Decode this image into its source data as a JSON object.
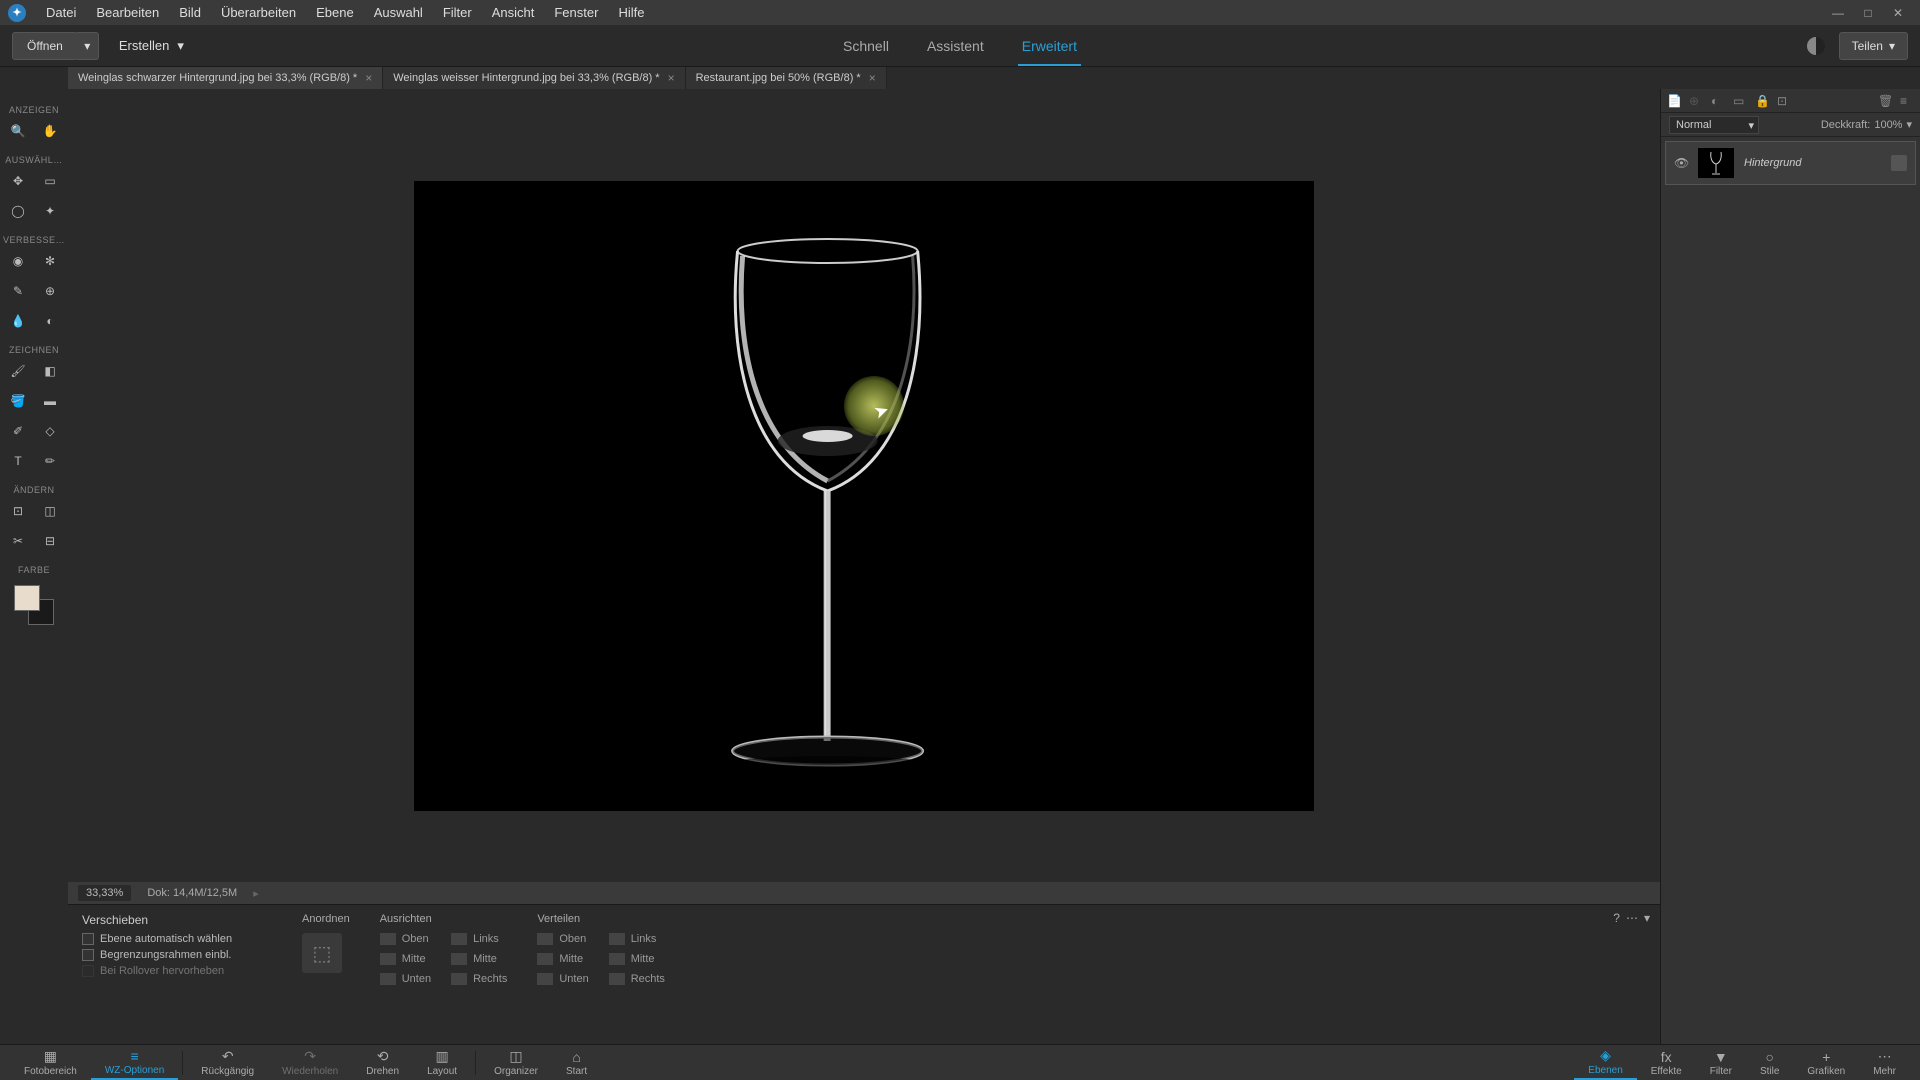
{
  "menu": {
    "items": [
      "Datei",
      "Bearbeiten",
      "Bild",
      "Überarbeiten",
      "Ebene",
      "Auswahl",
      "Filter",
      "Ansicht",
      "Fenster",
      "Hilfe"
    ]
  },
  "actionbar": {
    "open": "Öffnen",
    "create": "Erstellen",
    "share": "Teilen"
  },
  "modes": {
    "quick": "Schnell",
    "guided": "Assistent",
    "expert": "Erweitert"
  },
  "tabs": [
    {
      "label": "Weinglas schwarzer Hintergrund.jpg bei 33,3% (RGB/8) *",
      "active": true
    },
    {
      "label": "Weinglas weisser Hintergrund.jpg bei 33,3% (RGB/8) *",
      "active": false
    },
    {
      "label": "Restaurant.jpg bei 50% (RGB/8) *",
      "active": false
    }
  ],
  "toolbar": {
    "sections": {
      "view": "ANZEIGEN",
      "select": "AUSWÄHL…",
      "enhance": "VERBESSE…",
      "draw": "ZEICHNEN",
      "modify": "ÄNDERN",
      "color": "FARBE"
    }
  },
  "status": {
    "zoom": "33,33%",
    "doc": "Dok: 14,4M/12,5M"
  },
  "options": {
    "title": "Verschieben",
    "check1": "Ebene automatisch wählen",
    "check2": "Begrenzungsrahmen einbl.",
    "check3": "Bei Rollover hervorheben",
    "arrange": "Anordnen",
    "align": "Ausrichten",
    "distribute": "Verteilen",
    "top": "Oben",
    "middle": "Mitte",
    "bottom": "Unten",
    "left": "Links",
    "center": "Mitte",
    "right": "Rechts"
  },
  "layers": {
    "blend": "Normal",
    "opacity_label": "Deckkraft:",
    "opacity_value": "100%",
    "layer_name": "Hintergrund"
  },
  "bottom": {
    "left": [
      {
        "label": "Fotobereich",
        "icon": "▦"
      },
      {
        "label": "WZ-Optionen",
        "icon": "≡",
        "active": true
      },
      {
        "label": "Rückgängig",
        "icon": "↶"
      },
      {
        "label": "Wiederholen",
        "icon": "↷"
      },
      {
        "label": "Drehen",
        "icon": "⟲"
      },
      {
        "label": "Layout",
        "icon": "▥"
      }
    ],
    "center": [
      {
        "label": "Organizer",
        "icon": "◫"
      },
      {
        "label": "Start",
        "icon": "⌂"
      }
    ],
    "right": [
      {
        "label": "Ebenen",
        "icon": "◈",
        "active": true
      },
      {
        "label": "Effekte",
        "icon": "fx"
      },
      {
        "label": "Filter",
        "icon": "▼"
      },
      {
        "label": "Stile",
        "icon": "○"
      },
      {
        "label": "Grafiken",
        "icon": "+"
      },
      {
        "label": "Mehr",
        "icon": "⋯"
      }
    ]
  }
}
